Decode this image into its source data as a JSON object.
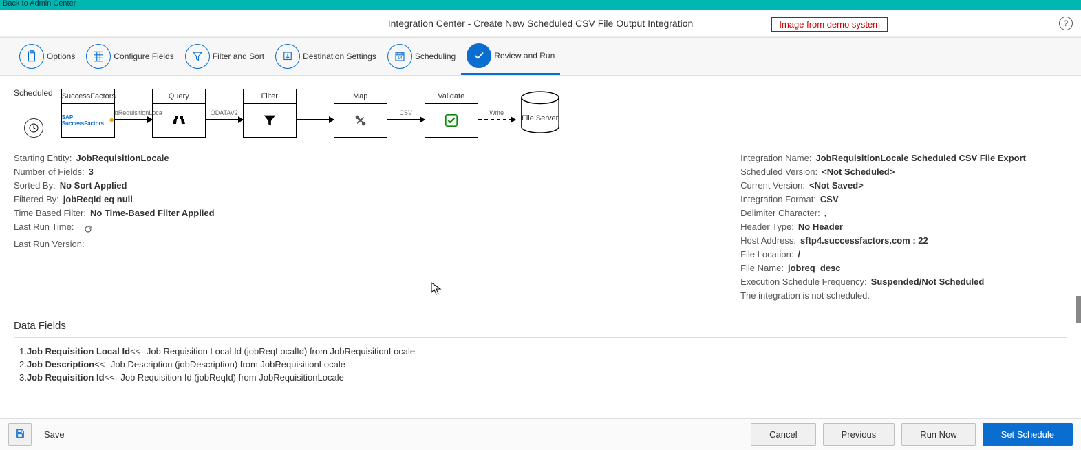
{
  "top_link": "Back to Admin Center",
  "page_title": "Integration Center - Create New Scheduled CSV File Output Integration",
  "demo_banner": "Image from demo system",
  "wizard": {
    "steps": [
      {
        "label": "Options"
      },
      {
        "label": "Configure Fields"
      },
      {
        "label": "Filter and Sort"
      },
      {
        "label": "Destination Settings"
      },
      {
        "label": "Scheduling"
      },
      {
        "label": "Review and Run"
      }
    ]
  },
  "flow": {
    "scheduled_label": "Scheduled",
    "nodes": {
      "sf": "SuccessFactors",
      "sf_body": "SAP SuccessFactors",
      "query": "Query",
      "filter": "Filter",
      "map": "Map",
      "validate": "Validate",
      "fileserver": "File Server"
    },
    "arrows": {
      "a1": "bRequisitionLoca",
      "a2": "ODATAV2",
      "a3": "",
      "a4": "CSV",
      "a5": "",
      "a6": "Write"
    }
  },
  "left_details": {
    "starting_entity_k": "Starting Entity:",
    "starting_entity_v": "JobRequisitionLocale",
    "num_fields_k": "Number of Fields:",
    "num_fields_v": "3",
    "sorted_k": "Sorted By:",
    "sorted_v": "No Sort Applied",
    "filtered_k": "Filtered By:",
    "filtered_v": "jobReqId eq null",
    "time_filter_k": "Time Based Filter:",
    "time_filter_v": "No Time-Based Filter Applied",
    "last_run_time_k": "Last Run Time:",
    "last_run_version_k": "Last Run Version:"
  },
  "right_details": {
    "int_name_k": "Integration Name:",
    "int_name_v": "JobRequisitionLocale Scheduled CSV File Export",
    "sched_ver_k": "Scheduled Version:",
    "sched_ver_v": "<Not Scheduled>",
    "cur_ver_k": "Current Version:",
    "cur_ver_v": "<Not Saved>",
    "format_k": "Integration Format:",
    "format_v": "CSV",
    "delim_k": "Delimiter Character:",
    "delim_v": ",",
    "header_k": "Header Type:",
    "header_v": "No Header",
    "host_k": "Host Address:",
    "host_v": "sftp4.successfactors.com  :  22",
    "loc_k": "File Location:",
    "loc_v": "/",
    "fname_k": "File Name:",
    "fname_v": "jobreq_desc",
    "freq_k": "Execution Schedule Frequency:",
    "freq_v": "Suspended/Not Scheduled",
    "not_sched": "The integration is not scheduled."
  },
  "data_fields_hdr": "Data Fields",
  "data_fields": [
    {
      "idx": "1.",
      "b": "Job Requisition Local Id",
      "rest": "<<--Job Requisition Local Id (jobReqLocalId) from JobRequisitionLocale"
    },
    {
      "idx": "2.",
      "b": "Job Description",
      "rest": "<<--Job Description (jobDescription) from JobRequisitionLocale"
    },
    {
      "idx": "3.",
      "b": "Job Requisition Id",
      "rest": "<<--Job Requisition Id (jobReqId) from JobRequisitionLocale"
    }
  ],
  "footer": {
    "save": "Save",
    "cancel": "Cancel",
    "previous": "Previous",
    "run_now": "Run Now",
    "set_schedule": "Set Schedule"
  }
}
